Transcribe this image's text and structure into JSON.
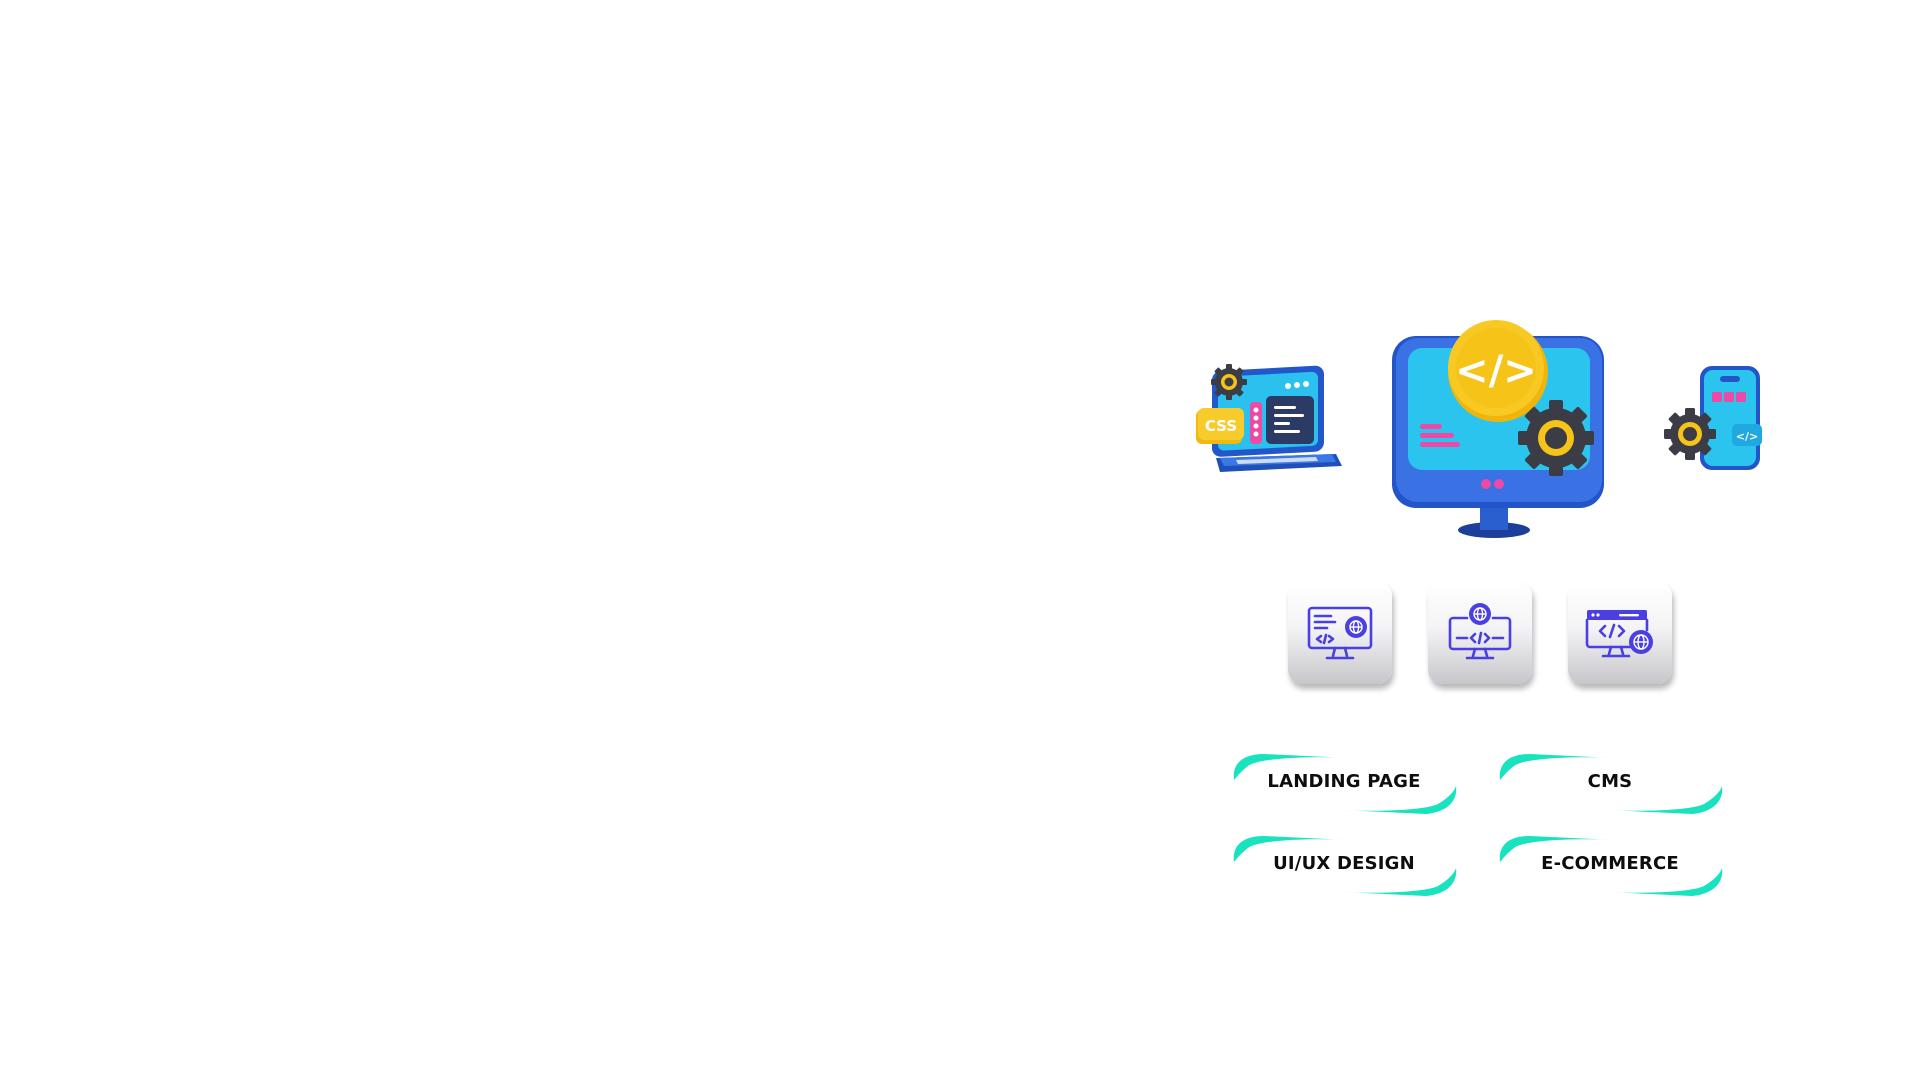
{
  "colors": {
    "background": "#ffffff",
    "accent_teal": "#19e3be",
    "brand_blue": "#2f6de0",
    "screen_cyan": "#29c4ee",
    "gold": "#f6c319",
    "pink": "#ec4aa5",
    "icon_purple": "#4a3fe0",
    "label_text": "#0d0d0d"
  },
  "illustrations": [
    {
      "icon": "css-laptop-icon",
      "text": "CSS"
    },
    {
      "icon": "code-monitor-icon",
      "text": "</>"
    },
    {
      "icon": "mobile-dev-icon",
      "text": "</>"
    }
  ],
  "tiles": [
    {
      "icon": "monitor-code-globe-icon"
    },
    {
      "icon": "globe-monitor-code-icon"
    },
    {
      "icon": "browser-code-globe-icon"
    }
  ],
  "services": [
    {
      "label": "LANDING PAGE"
    },
    {
      "label": "CMS"
    },
    {
      "label": "UI/UX DESIGN"
    },
    {
      "label": "E-COMMERCE"
    }
  ]
}
